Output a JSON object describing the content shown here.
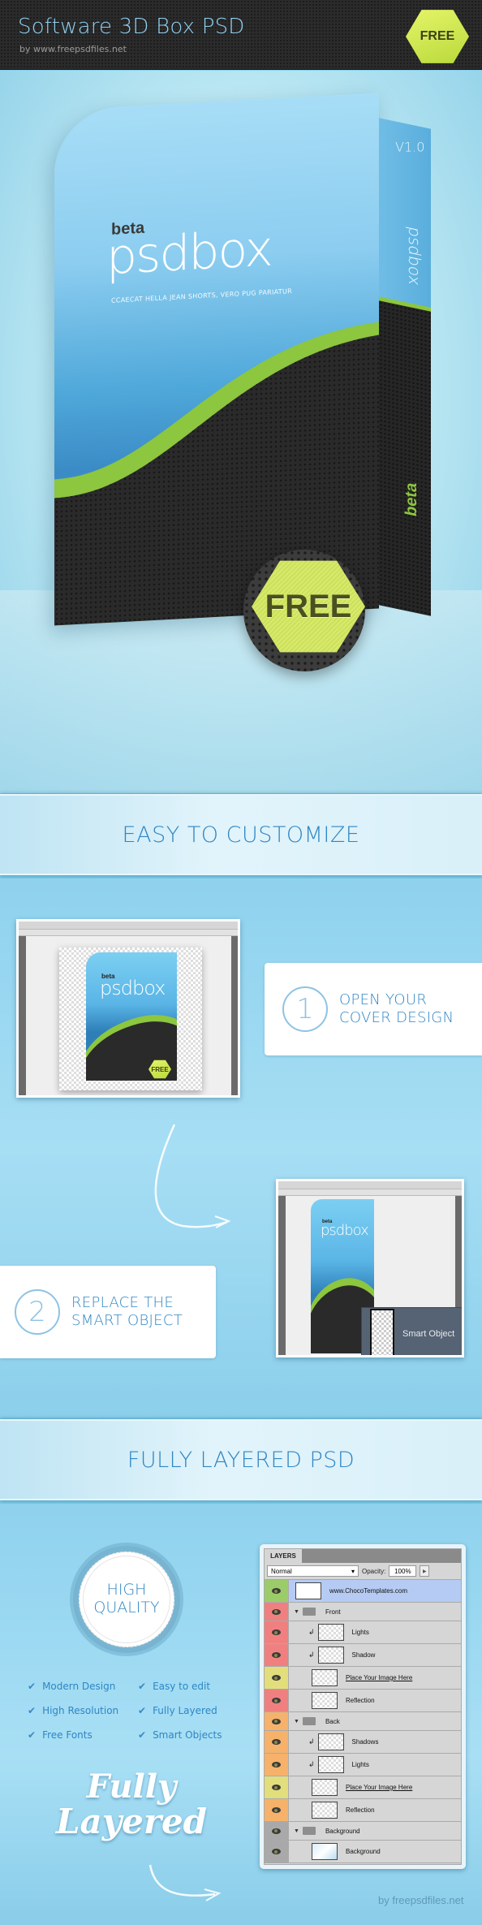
{
  "header": {
    "title": "Software 3D Box PSD",
    "subtitle": "by www.freepsdfiles.net",
    "badge": "FREE",
    "badge_color": "#c9e24c"
  },
  "hero": {
    "cover_beta": "beta",
    "cover_logo": "psdbox",
    "cover_tagline": "CCAECAT HELLA JEAN SHORTS, VERO PUG PARIATUR",
    "side_version": "V1.0",
    "side_logo": "psdbox",
    "side_beta": "beta",
    "free_badge": "FREE"
  },
  "sections": {
    "customize_title": "EASY TO CUSTOMIZE",
    "layered_title": "FULLY LAYERED PSD"
  },
  "steps": [
    {
      "number": "1",
      "line1": "OPEN YOUR",
      "line2": "COVER DESIGN"
    },
    {
      "number": "2",
      "line1": "REPLACE THE",
      "line2": "SMART OBJECT"
    }
  ],
  "screenshots": {
    "ps1": {
      "beta": "beta",
      "logo": "psdbox",
      "badge": "FREE"
    },
    "ps2": {
      "beta": "beta",
      "logo": "psdbox",
      "smart_object_label": "Smart Object"
    }
  },
  "quality": {
    "line1": "HIGH",
    "line2": "QUALITY"
  },
  "features": [
    "Modern Design",
    "Easy to edit",
    "High Resolution",
    "Fully Layered",
    "Free Fonts",
    "Smart Objects"
  ],
  "script_title": {
    "line1": "Fully",
    "line2": "Layered"
  },
  "layers_panel": {
    "tab": "LAYERS",
    "blend_mode": "Normal",
    "opacity_label": "Opacity:",
    "opacity_value": "100%",
    "rows": [
      {
        "name": "www.ChocoTemplates.com",
        "color": "green",
        "type": "layer"
      },
      {
        "name": "Front",
        "color": "red",
        "type": "group"
      },
      {
        "name": "Lights",
        "color": "red",
        "type": "clipped"
      },
      {
        "name": "Shadow",
        "color": "red",
        "type": "clipped"
      },
      {
        "name": "Place Your Image Here",
        "color": "yellow",
        "type": "smart-object"
      },
      {
        "name": "Reflection",
        "color": "red",
        "type": "layer"
      },
      {
        "name": "Back",
        "color": "orange",
        "type": "group"
      },
      {
        "name": "Shadows",
        "color": "orange",
        "type": "clipped"
      },
      {
        "name": "Lights",
        "color": "orange",
        "type": "clipped"
      },
      {
        "name": "Place Your Image Here",
        "color": "yellow",
        "type": "smart-object"
      },
      {
        "name": "Reflection",
        "color": "orange",
        "type": "layer"
      },
      {
        "name": "Background",
        "color": "gray",
        "type": "group"
      },
      {
        "name": "Background",
        "color": "gray",
        "type": "layer"
      }
    ]
  },
  "footer": {
    "credit": "by freepsdfiles.net"
  }
}
